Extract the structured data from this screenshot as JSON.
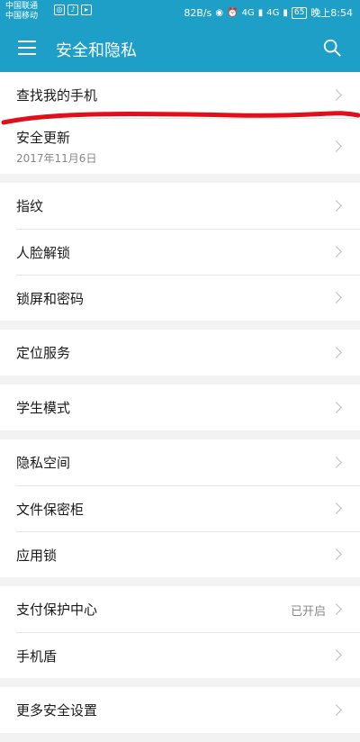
{
  "statusbar": {
    "carrier1": "中国联通",
    "carrier2": "中国移动",
    "net_speed": "82B/s",
    "battery": "65",
    "time": "晚上8:54",
    "net1": "4G",
    "net2": "4G"
  },
  "header": {
    "title": "安全和隐私"
  },
  "groups": [
    {
      "items": [
        {
          "label": "查找我的手机"
        },
        {
          "label": "安全更新",
          "sub": "2017年11月6日"
        }
      ]
    },
    {
      "items": [
        {
          "label": "指纹"
        },
        {
          "label": "人脸解锁"
        },
        {
          "label": "锁屏和密码"
        }
      ]
    },
    {
      "items": [
        {
          "label": "定位服务"
        }
      ]
    },
    {
      "items": [
        {
          "label": "学生模式"
        }
      ]
    },
    {
      "items": [
        {
          "label": "隐私空间"
        },
        {
          "label": "文件保密柜"
        },
        {
          "label": "应用锁"
        }
      ]
    },
    {
      "items": [
        {
          "label": "支付保护中心",
          "status": "已开启"
        },
        {
          "label": "手机盾"
        }
      ]
    },
    {
      "items": [
        {
          "label": "更多安全设置"
        }
      ]
    }
  ],
  "colors": {
    "accent": "#1d9fc7",
    "annotation": "#e0101a"
  }
}
